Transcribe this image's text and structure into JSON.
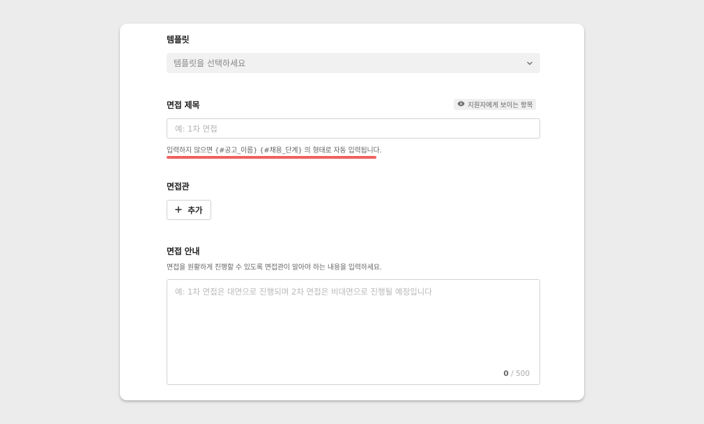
{
  "template": {
    "label": "템플릿",
    "select_value": "템플릿을 선택하세요"
  },
  "interview_title": {
    "label": "면접 제목",
    "visibility_badge": "지원자에게 보이는 항목",
    "placeholder": "예: 1차 면접",
    "helper": "입력하지 않으면 {#공고_이름} {#채용_단계} 의 형태로 자동 입력됩니다."
  },
  "interviewer": {
    "label": "면접관",
    "add_button": "추가"
  },
  "interview_guide": {
    "label": "면접 안내",
    "description": "면접을 원활하게 진행할 수 있도록 면접관이 알아야 하는 내용을 입력하세요.",
    "placeholder": "예: 1차 면접은 대면으로 진행되며 2차 면접은 비대면으로 진행될 예정입니다",
    "char_count": "0",
    "char_limit": "/ 500"
  },
  "icons": {
    "select": "chevron-down-icon",
    "badge": "eye-icon",
    "add": "plus-icon"
  },
  "colors": {
    "highlight_underline": "#f06060",
    "select_background": "#f1f1f1",
    "page_background": "#ececec"
  }
}
